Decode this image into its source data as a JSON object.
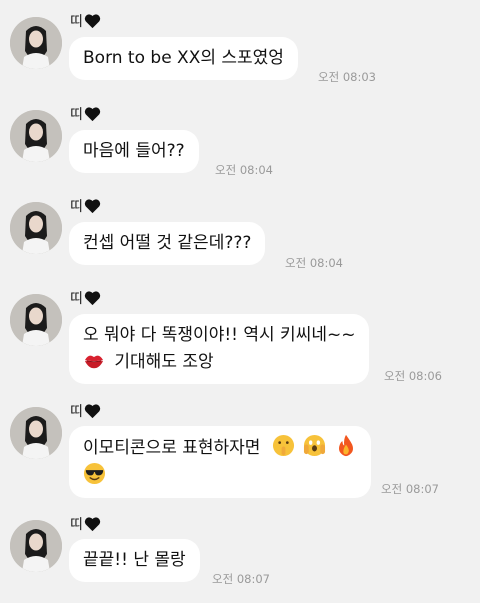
{
  "sender": {
    "name": "띠"
  },
  "icons": {
    "heart": "black-heart-icon",
    "avatar": "profile-photo"
  },
  "messages": [
    {
      "text": "Born to be XX의 스포였엉",
      "time": "오전 08:03"
    },
    {
      "text": "마음에 들어??",
      "time": "오전 08:04"
    },
    {
      "text": "컨셉 어떨 것 같은데???",
      "time": "오전 08:04"
    },
    {
      "line1": "오 뭐야 다 똑쟁이야!! 역시 키씨네~~",
      "line2": "기대해도 조앙",
      "emojis": [
        "kiss-mark-icon"
      ],
      "time": "오전 08:06"
    },
    {
      "line1": "이모티콘으로 표현하자면",
      "emojis": [
        "shushing-face-icon",
        "screaming-face-icon",
        "fire-icon",
        "sunglasses-face-icon"
      ],
      "time": "오전 08:07"
    },
    {
      "text": "끝끝!! 난 몰랑",
      "time": "오전 08:07"
    }
  ],
  "colors": {
    "background": "#f1f1f1",
    "bubble": "#ffffff",
    "time": "#9a9a9a"
  }
}
